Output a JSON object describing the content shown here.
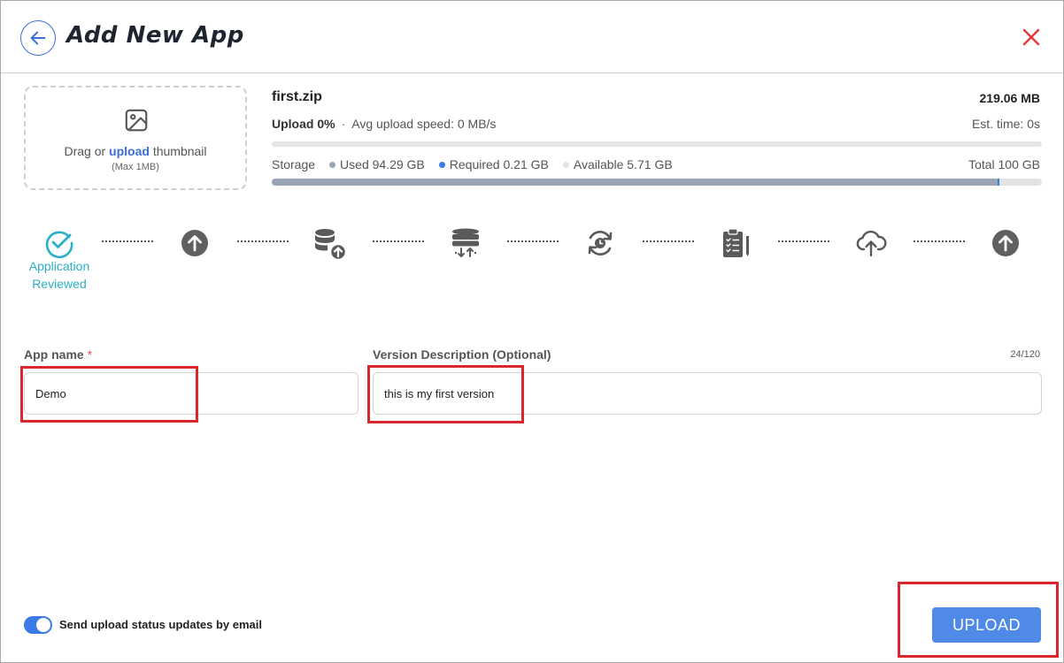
{
  "header": {
    "title": "Add New App",
    "back_icon": "arrow-left-icon",
    "close_icon": "close-icon",
    "close_color": "#e53935"
  },
  "thumbnail": {
    "icon": "image-icon",
    "text_prefix": "Drag or",
    "link_text": "upload",
    "text_suffix": "thumbnail",
    "max_text": "(Max 1MB)"
  },
  "upload": {
    "filename": "first.zip",
    "filesize": "219.06 MB",
    "progress_label": "Upload 0%",
    "progress": 0,
    "speed": "Avg upload speed: 0 MB/s",
    "est_time": "Est. time: 0s"
  },
  "storage": {
    "label": "Storage",
    "used": "Used 94.29 GB",
    "required": "Required 0.21 GB",
    "available": "Available 5.71 GB",
    "total": "Total 100 GB",
    "used_fraction": 0.9429,
    "required_fraction": 0.0021,
    "colors": {
      "used": "#99a4b4",
      "required": "#3b7be8",
      "available": "#e3e3e3"
    }
  },
  "steps": [
    {
      "icon": "check-circle-icon",
      "label": "Application Reviewed",
      "state": "done"
    },
    {
      "icon": "arrow-up-circle-icon",
      "state": "pending"
    },
    {
      "icon": "database-upload-icon",
      "state": "pending"
    },
    {
      "icon": "database-transfer-icon",
      "state": "pending"
    },
    {
      "icon": "sync-clock-icon",
      "state": "pending"
    },
    {
      "icon": "clipboard-list-icon",
      "state": "pending"
    },
    {
      "icon": "cloud-upload-icon",
      "state": "pending"
    },
    {
      "icon": "arrow-up-circle-icon",
      "state": "pending"
    }
  ],
  "form": {
    "app_name_label": "App name",
    "required_marker": "*",
    "app_name_value": "Demo",
    "version_label": "Version Description (Optional)",
    "version_value": "this is my first version",
    "version_counter": "24/120"
  },
  "footer": {
    "email_toggle_label": "Send upload status updates by email",
    "email_toggle_on": true,
    "upload_button": "UPLOAD"
  },
  "colors": {
    "accent": "#3b7be8",
    "step_done": "#2ab0c5",
    "highlight": "#d9282d"
  }
}
